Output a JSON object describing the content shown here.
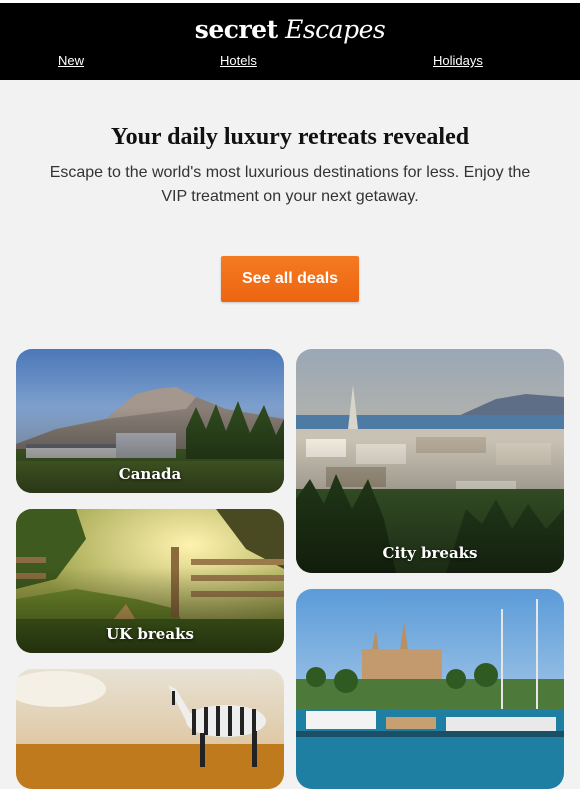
{
  "brand": {
    "logo_part1": "secret",
    "logo_part2": "Escapes"
  },
  "nav": {
    "items": [
      "New",
      "Hotels",
      "Holidays"
    ]
  },
  "hero": {
    "title": "Your daily luxury retreats revealed",
    "subtitle": "Escape to the world's most luxurious destinations for less. Enjoy the VIP treatment on your next getaway."
  },
  "cta": {
    "label": "See all deals"
  },
  "cards": [
    {
      "label": "Canada"
    },
    {
      "label": "City breaks"
    },
    {
      "label": "UK breaks"
    },
    {
      "label": ""
    },
    {
      "label": ""
    }
  ],
  "colors": {
    "header_bg": "#000000",
    "cta": "#f07018",
    "page_bg": "#f2f2f2"
  }
}
